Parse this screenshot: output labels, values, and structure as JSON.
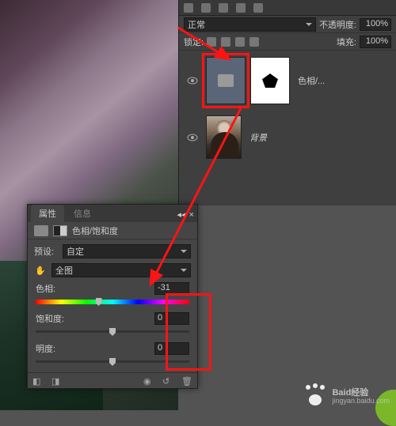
{
  "layers_panel": {
    "blend_mode": "正常",
    "opacity_label": "不透明度:",
    "opacity_value": "100%",
    "lock_label": "锁定:",
    "fill_label": "填充:",
    "fill_value": "100%",
    "adjustment_layer_name": "色相/...",
    "background_layer_name": "背景"
  },
  "props_panel": {
    "tabs": {
      "active": "属性",
      "inactive": "信息"
    },
    "title": "色相/饱和度",
    "preset_label": "预设:",
    "preset_value": "自定",
    "range_value": "全图",
    "sliders": {
      "hue_label": "色相:",
      "hue_value": "-31",
      "sat_label": "饱和度:",
      "sat_value": "0",
      "light_label": "明度:",
      "light_value": "0"
    }
  },
  "watermark": {
    "brand": "Baid",
    "sub": "经验",
    "url": "jingyan.baidu.com"
  }
}
